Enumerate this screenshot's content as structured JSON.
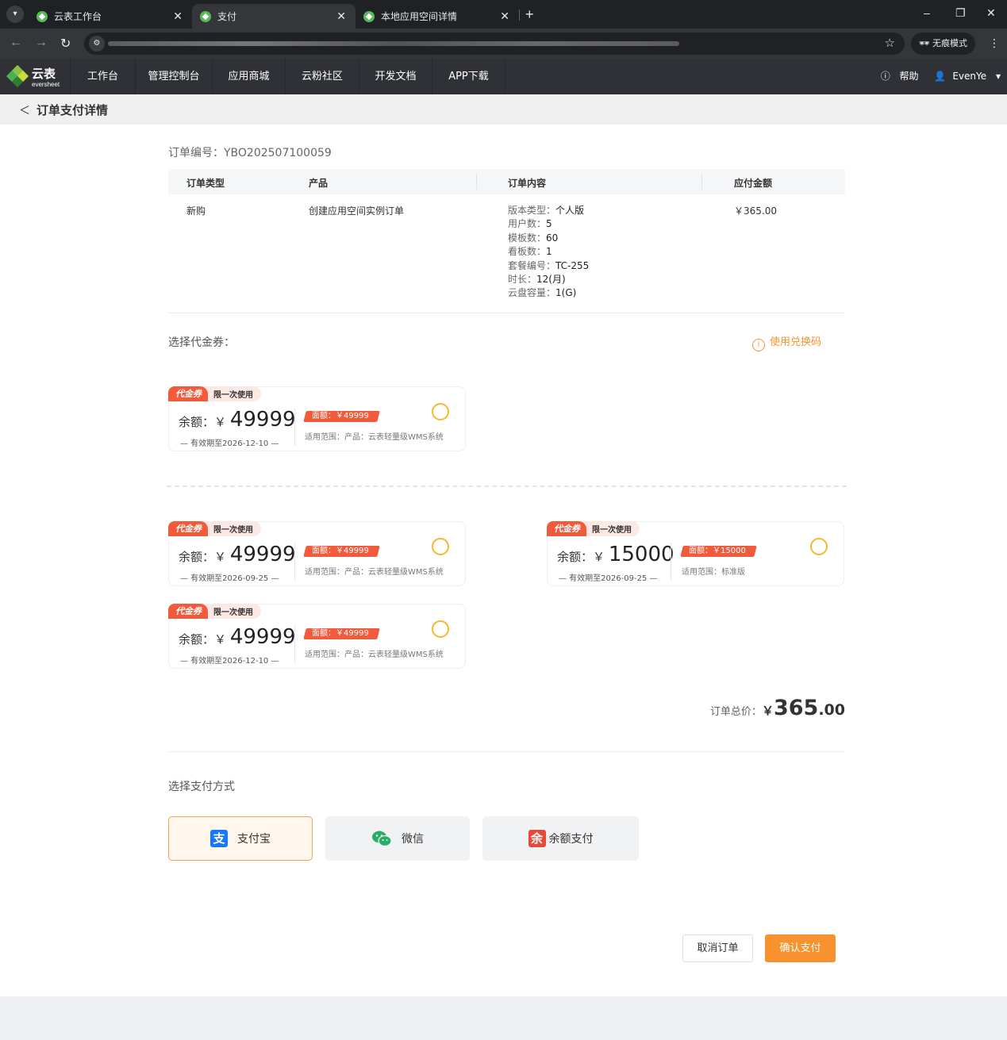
{
  "browser": {
    "tabs": [
      {
        "title": "云表工作台",
        "active": false
      },
      {
        "title": "支付",
        "active": true
      },
      {
        "title": "本地应用空间详情",
        "active": false
      }
    ],
    "incognito_label": "无痕模式"
  },
  "header": {
    "logo_title": "云表",
    "logo_sub": "eversheet",
    "nav": [
      "工作台",
      "管理控制台",
      "应用商城",
      "云粉社区",
      "开发文档",
      "APP下载"
    ],
    "help": "帮助",
    "user": "EvenYe"
  },
  "page": {
    "title": "订单支付详情",
    "order_no": "订单编号：YBO202507100059"
  },
  "order_table": {
    "headers": [
      "订单类型",
      "产品",
      "订单内容",
      "应付金额"
    ],
    "row": {
      "type": "新购",
      "product": "创建应用空间实例订单",
      "content": [
        {
          "label": "版本类型：",
          "value": "个人版"
        },
        {
          "label": "用户数：",
          "value": "5"
        },
        {
          "label": "模板数：",
          "value": "60"
        },
        {
          "label": "看板数：",
          "value": "1"
        },
        {
          "label": "套餐编号：",
          "value": "TC-255"
        },
        {
          "label": "时长：",
          "value": "12(月)"
        },
        {
          "label": "云盘容量：",
          "value": "1(G)"
        }
      ],
      "amount": "￥365.00"
    }
  },
  "voucher": {
    "label": "选择代金券：",
    "redeem": "使用兑换码",
    "tag": "代金券",
    "tag_note": "限一次使用",
    "balance_label": "余额：",
    "currency": "￥",
    "items": [
      {
        "amount": "49999",
        "expiry": "— 有效期至2026-12-10 —",
        "face": "面额：￥49999",
        "scope": "适用范围：产品：云表轻量级WMS系统"
      },
      {
        "amount": "49999",
        "expiry": "— 有效期至2026-09-25 —",
        "face": "面额：￥49999",
        "scope": "适用范围：产品：云表轻量级WMS系统"
      },
      {
        "amount": "15000",
        "expiry": "— 有效期至2026-09-25 —",
        "face": "面额：￥15000",
        "scope": "适用范围：标准版"
      },
      {
        "amount": "49999",
        "expiry": "— 有效期至2026-12-10 —",
        "face": "面额：￥49999",
        "scope": "适用范围：产品：云表轻量级WMS系统"
      }
    ]
  },
  "total": {
    "label": "订单总价：",
    "currency": "￥",
    "integer": "365",
    "decimal": ".00"
  },
  "payment": {
    "label": "选择支付方式",
    "methods": [
      {
        "name": "支付宝",
        "icon": "alipay-icon",
        "selected": true,
        "color": "#1677ff"
      },
      {
        "name": "微信",
        "icon": "wechat-icon",
        "selected": false,
        "color": "#2aae67"
      },
      {
        "name": "余额支付",
        "icon": "balance-icon",
        "selected": false,
        "color": "#e64a3b"
      }
    ]
  },
  "actions": {
    "cancel": "取消订单",
    "confirm": "确认支付"
  },
  "colors": {
    "accent": "#f7922e",
    "coupon_red": "#f15a3b",
    "header_bg": "#2f3136"
  }
}
